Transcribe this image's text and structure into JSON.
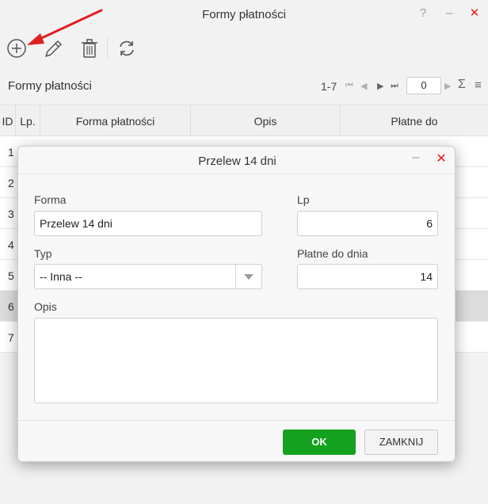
{
  "window": {
    "title": "Formy płatności",
    "help_icon": "?",
    "minimize_icon": "–",
    "close_icon": "✕"
  },
  "toolbar": {
    "icons": [
      "plus-circle-icon",
      "pencil-icon",
      "trash-icon",
      "refresh-icon"
    ]
  },
  "grid": {
    "title": "Formy płatności",
    "pager": {
      "range": "1-7",
      "page_value": "0"
    },
    "columns": [
      "ID",
      "Lp.",
      "Forma płatności",
      "Opis",
      "Płatne do"
    ],
    "row_ids": [
      "1",
      "2",
      "3",
      "4",
      "5",
      "6",
      "7"
    ],
    "selected_row": "6"
  },
  "dialog": {
    "title": "Przelew 14 dni",
    "forma_label": "Forma",
    "forma_value": "Przelew 14 dni",
    "lp_label": "Lp",
    "lp_value": "6",
    "typ_label": "Typ",
    "typ_value": "-- Inna --",
    "platne_label": "Płatne do dnia",
    "platne_value": "14",
    "opis_label": "Opis",
    "opis_value": "",
    "ok_label": "OK",
    "close_label": "ZAMKNIJ"
  },
  "colors": {
    "accent_green": "#14a21e",
    "close_red": "#e02020",
    "annotation_arrow": "#e02020"
  }
}
